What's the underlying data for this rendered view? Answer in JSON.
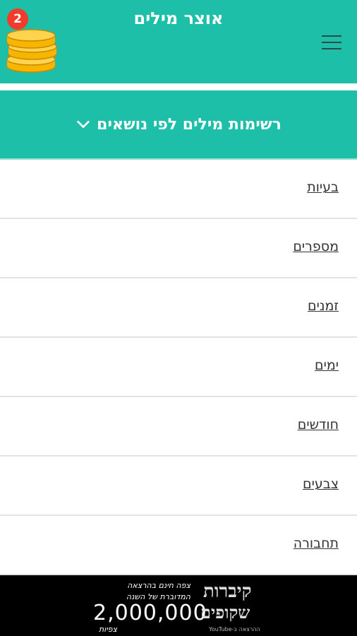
{
  "header": {
    "title": "אוצר מילים",
    "coins_count": "2",
    "coin_icon": "coins-stack-icon",
    "menu_icon": "hamburger-menu-icon",
    "background": "#1dbfa8"
  },
  "section": {
    "title": "רשימות מילים לפי נושאים",
    "chevron_icon": "chevron-down-icon"
  },
  "categories": [
    {
      "label": "בעיות"
    },
    {
      "label": "מספרים"
    },
    {
      "label": "זמנים"
    },
    {
      "label": "ימים"
    },
    {
      "label": "חודשים"
    },
    {
      "label": "צבעים"
    },
    {
      "label": "תחבורה"
    }
  ],
  "ad": {
    "line1": "צפה חינם בהרצאה",
    "line2": "המדוברת של השנה",
    "number": "2,000,000",
    "views": "צפיות",
    "logo_top": "קיברות",
    "logo_bottom": "שקופים",
    "logo_sub": "ההרצאה ב-YouTube"
  }
}
